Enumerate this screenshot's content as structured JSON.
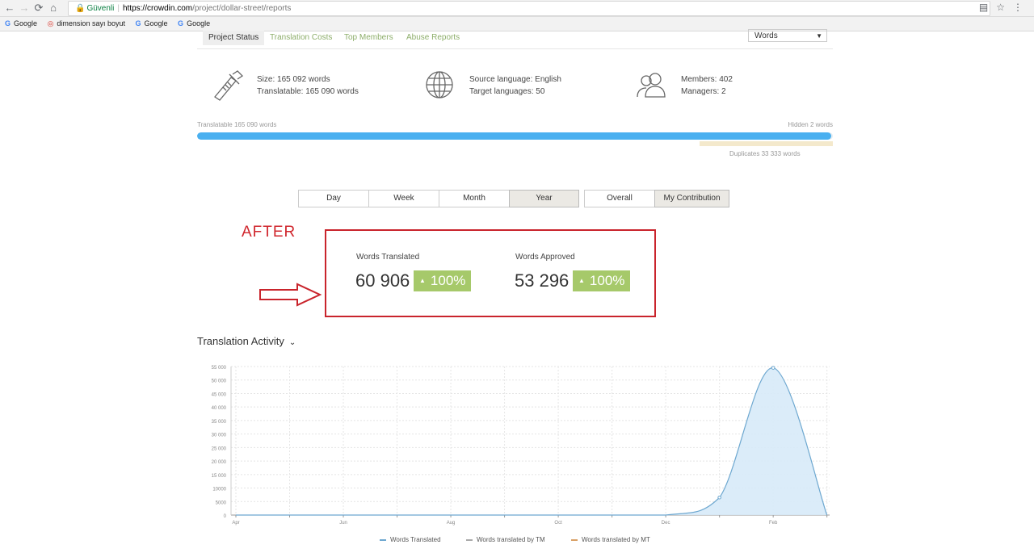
{
  "browser": {
    "secure_label": "Güvenli",
    "url_host": "https://crowdin.com",
    "url_path": "/project/dollar-street/reports",
    "bookmarks": [
      "Google",
      "dimension sayı boyut",
      "Google",
      "Google"
    ]
  },
  "tabs": [
    "Project Status",
    "Translation Costs",
    "Top Members",
    "Abuse Reports"
  ],
  "unit_select": {
    "value": "Words"
  },
  "stats": {
    "size": "Size: 165 092 words",
    "translatable": "Translatable: 165 090 words",
    "source_language": "Source language: English",
    "target_languages": "Target languages: 50",
    "members": "Members: 402",
    "managers": "Managers: 2"
  },
  "progress": {
    "translatable_label": "Translatable 165 090 words",
    "hidden_label": "Hidden 2 words",
    "duplicates_label": "Duplicates 33 333 words",
    "fill_fraction": 0.997
  },
  "period_buttons": [
    "Day",
    "Week",
    "Month",
    "Year"
  ],
  "scope_buttons": [
    "Overall",
    "My Contribution"
  ],
  "active_period": "Year",
  "active_scope": "My Contribution",
  "annotation": {
    "label": "AFTER"
  },
  "metrics": [
    {
      "label": "Words Translated",
      "value": "60 906",
      "badge": "100%"
    },
    {
      "label": "Words Approved",
      "value": "53 296",
      "badge": "100%"
    }
  ],
  "activity": {
    "title": "Translation Activity"
  },
  "colors": {
    "accent_green": "#8dae6a",
    "badge_green": "#a6c96a",
    "progress_blue": "#4ab0f0",
    "annotation_red": "#c9242c",
    "area_fill": "#d7eaf8",
    "area_line": "#6ea8d0"
  },
  "chart_data": {
    "type": "area",
    "x": [
      "Apr",
      "Jun",
      "Aug",
      "Oct",
      "Dec",
      "Feb"
    ],
    "y_ticks": [
      0,
      5000,
      10000,
      15000,
      20000,
      25000,
      30000,
      35000,
      40000,
      45000,
      50000,
      55000
    ],
    "y_tick_labels": [
      "0",
      "5000",
      "10000",
      "15 000",
      "20 000",
      "25 000",
      "30 000",
      "35 000",
      "40 000",
      "45 000",
      "50 000",
      "55 000"
    ],
    "ylim": [
      0,
      55000
    ],
    "grid": true,
    "series": [
      {
        "name": "Words Translated",
        "color": "#6ea8d0",
        "points": [
          [
            "Apr",
            0
          ],
          [
            "Jun",
            0
          ],
          [
            "Aug",
            0
          ],
          [
            "Oct",
            0
          ],
          [
            "Dec",
            0
          ],
          [
            "Jan",
            6500
          ],
          [
            "Feb",
            54500
          ],
          [
            "Mar",
            0
          ]
        ]
      },
      {
        "name": "Words translated by TM",
        "color": "#aaaaaa",
        "points": []
      },
      {
        "name": "Words translated by MT",
        "color": "#d9a066",
        "points": []
      }
    ],
    "legend_position": "bottom"
  }
}
